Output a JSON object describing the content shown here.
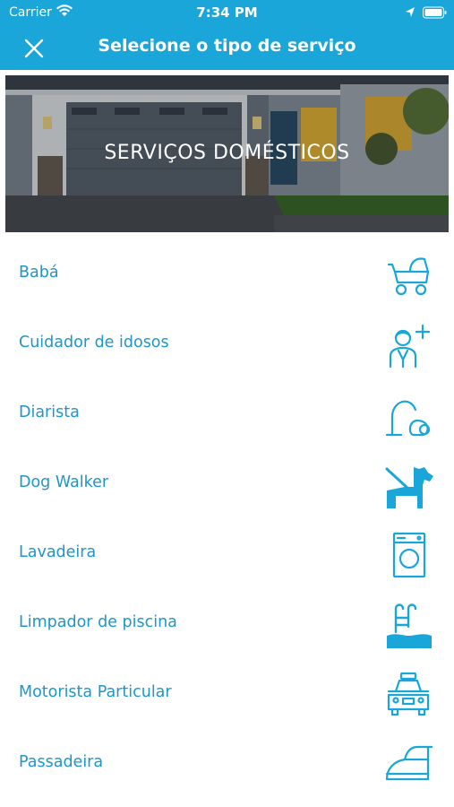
{
  "status_bar": {
    "carrier": "Carrier",
    "time": "7:34 PM"
  },
  "header": {
    "title": "Selecione o tipo de serviço",
    "close_icon": "close-icon"
  },
  "banner": {
    "label": "SERVIÇOS DOMÉSTICOS"
  },
  "services": [
    {
      "label": "Babá",
      "icon": "baby-stroller-icon"
    },
    {
      "label": "Cuidador de idosos",
      "icon": "elderly-care-icon"
    },
    {
      "label": "Diarista",
      "icon": "vacuum-cleaner-icon"
    },
    {
      "label": "Dog Walker",
      "icon": "dog-walker-icon"
    },
    {
      "label": "Lavadeira",
      "icon": "washing-machine-icon"
    },
    {
      "label": "Limpador de piscina",
      "icon": "pool-icon"
    },
    {
      "label": "Motorista Particular",
      "icon": "car-icon"
    },
    {
      "label": "Passadeira",
      "icon": "iron-icon"
    }
  ],
  "colors": {
    "accent": "#1aa6d9",
    "text": "#1f96c9",
    "background": "#ffffff"
  }
}
